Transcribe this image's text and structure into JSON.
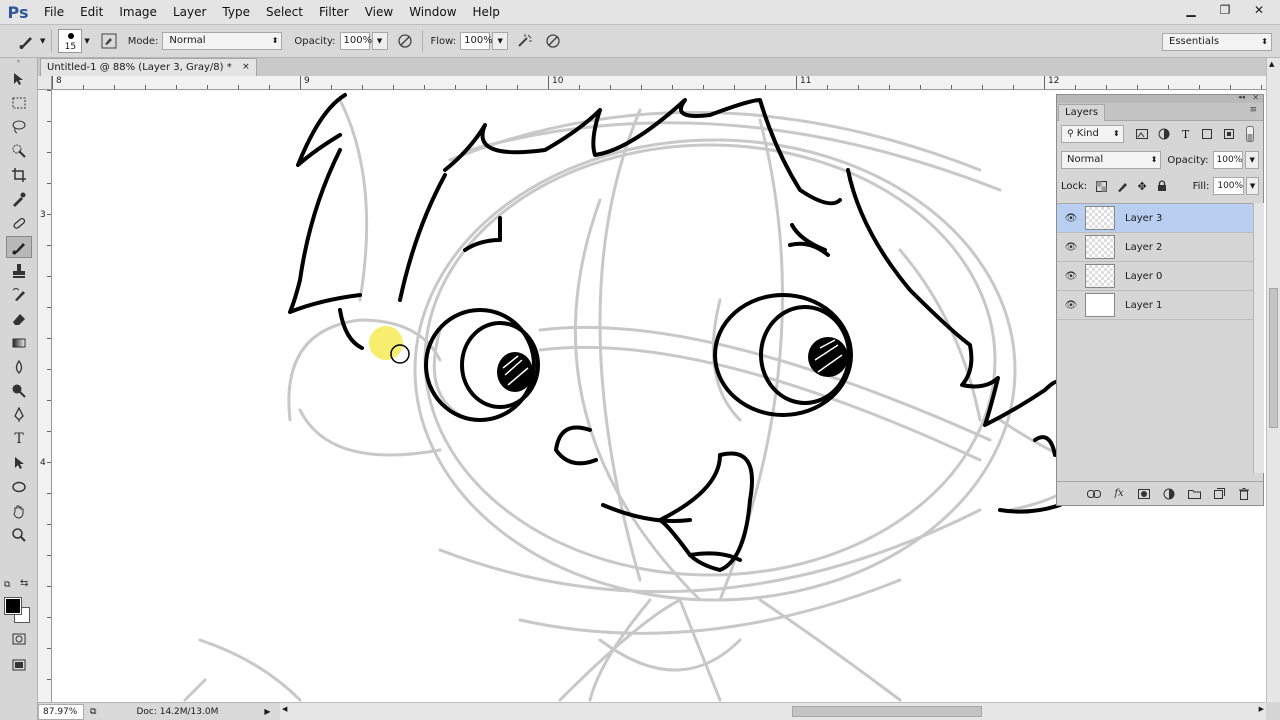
{
  "app": {
    "logo": "Ps"
  },
  "menu": [
    "File",
    "Edit",
    "Image",
    "Layer",
    "Type",
    "Select",
    "Filter",
    "View",
    "Window",
    "Help"
  ],
  "window_controls": {
    "minimize": "▁",
    "restore": "❐",
    "close": "✕"
  },
  "options_bar": {
    "brush_size": "15",
    "mode_label": "Mode:",
    "mode_value": "Normal",
    "opacity_label": "Opacity:",
    "opacity_value": "100%",
    "flow_label": "Flow:",
    "flow_value": "100%",
    "workspace": "Essentials"
  },
  "document": {
    "tab_title": "Untitled-1 @ 88% (Layer 3, Gray/8) *",
    "tab_close": "×",
    "ruler_top": [
      "8",
      "9",
      "10",
      "11",
      "12"
    ],
    "ruler_left": [
      "3",
      "4"
    ]
  },
  "status": {
    "zoom": "87.97%",
    "doc_info": "Doc: 14.2M/13.0M"
  },
  "layers_panel": {
    "tab": "Layers",
    "filter_kind": "Kind",
    "blend_mode": "Normal",
    "opacity_label": "Opacity:",
    "opacity_value": "100%",
    "lock_label": "Lock:",
    "fill_label": "Fill:",
    "fill_value": "100%",
    "layers": [
      {
        "name": "Layer 3",
        "selected": true
      },
      {
        "name": "Layer 2",
        "selected": false
      },
      {
        "name": "Layer 0",
        "selected": false
      },
      {
        "name": "Layer 1",
        "selected": false
      }
    ],
    "footer_fx": "fx"
  },
  "colors": {
    "accent_selected": "#b9cff2",
    "logo": "#2c5a9c",
    "cursor_highlight": "#f5e94a"
  }
}
